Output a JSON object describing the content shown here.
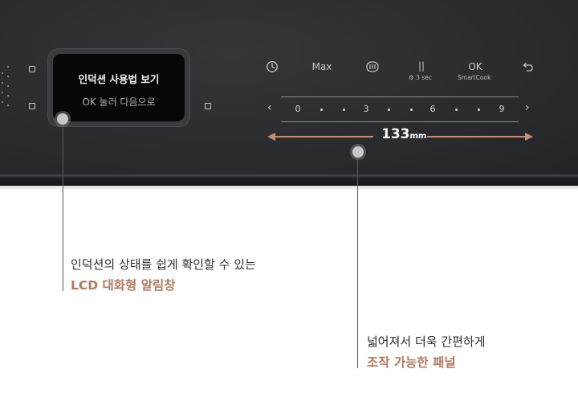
{
  "lcd": {
    "title": "인덕션 사용법 보기",
    "subtitle": "OK 눌러 다음으로"
  },
  "controls": {
    "timer_icon": "clock-icon",
    "max_label": "Max",
    "pan_icon": "pan-detect-icon",
    "pause_label": "||",
    "lock_sub": "3 sec",
    "ok_label": "OK",
    "ok_sub": "SmartCook",
    "back_icon": "back-arrow-icon"
  },
  "slider": {
    "labels": [
      "0",
      "3",
      "6",
      "9"
    ]
  },
  "dimension": {
    "value": "133",
    "unit": "mm"
  },
  "callouts": [
    {
      "line1": "인덕션의 상태를 쉽게 확인할 수 있는",
      "line2": "LCD 대화형 알림창"
    },
    {
      "line1": "넓어져서 더욱 간편하게",
      "line2": "조작 가능한 패널"
    }
  ],
  "colors": {
    "panel": "#2b2c30",
    "accent": "#b07a63",
    "dimension_arrow": "#c48f74"
  }
}
